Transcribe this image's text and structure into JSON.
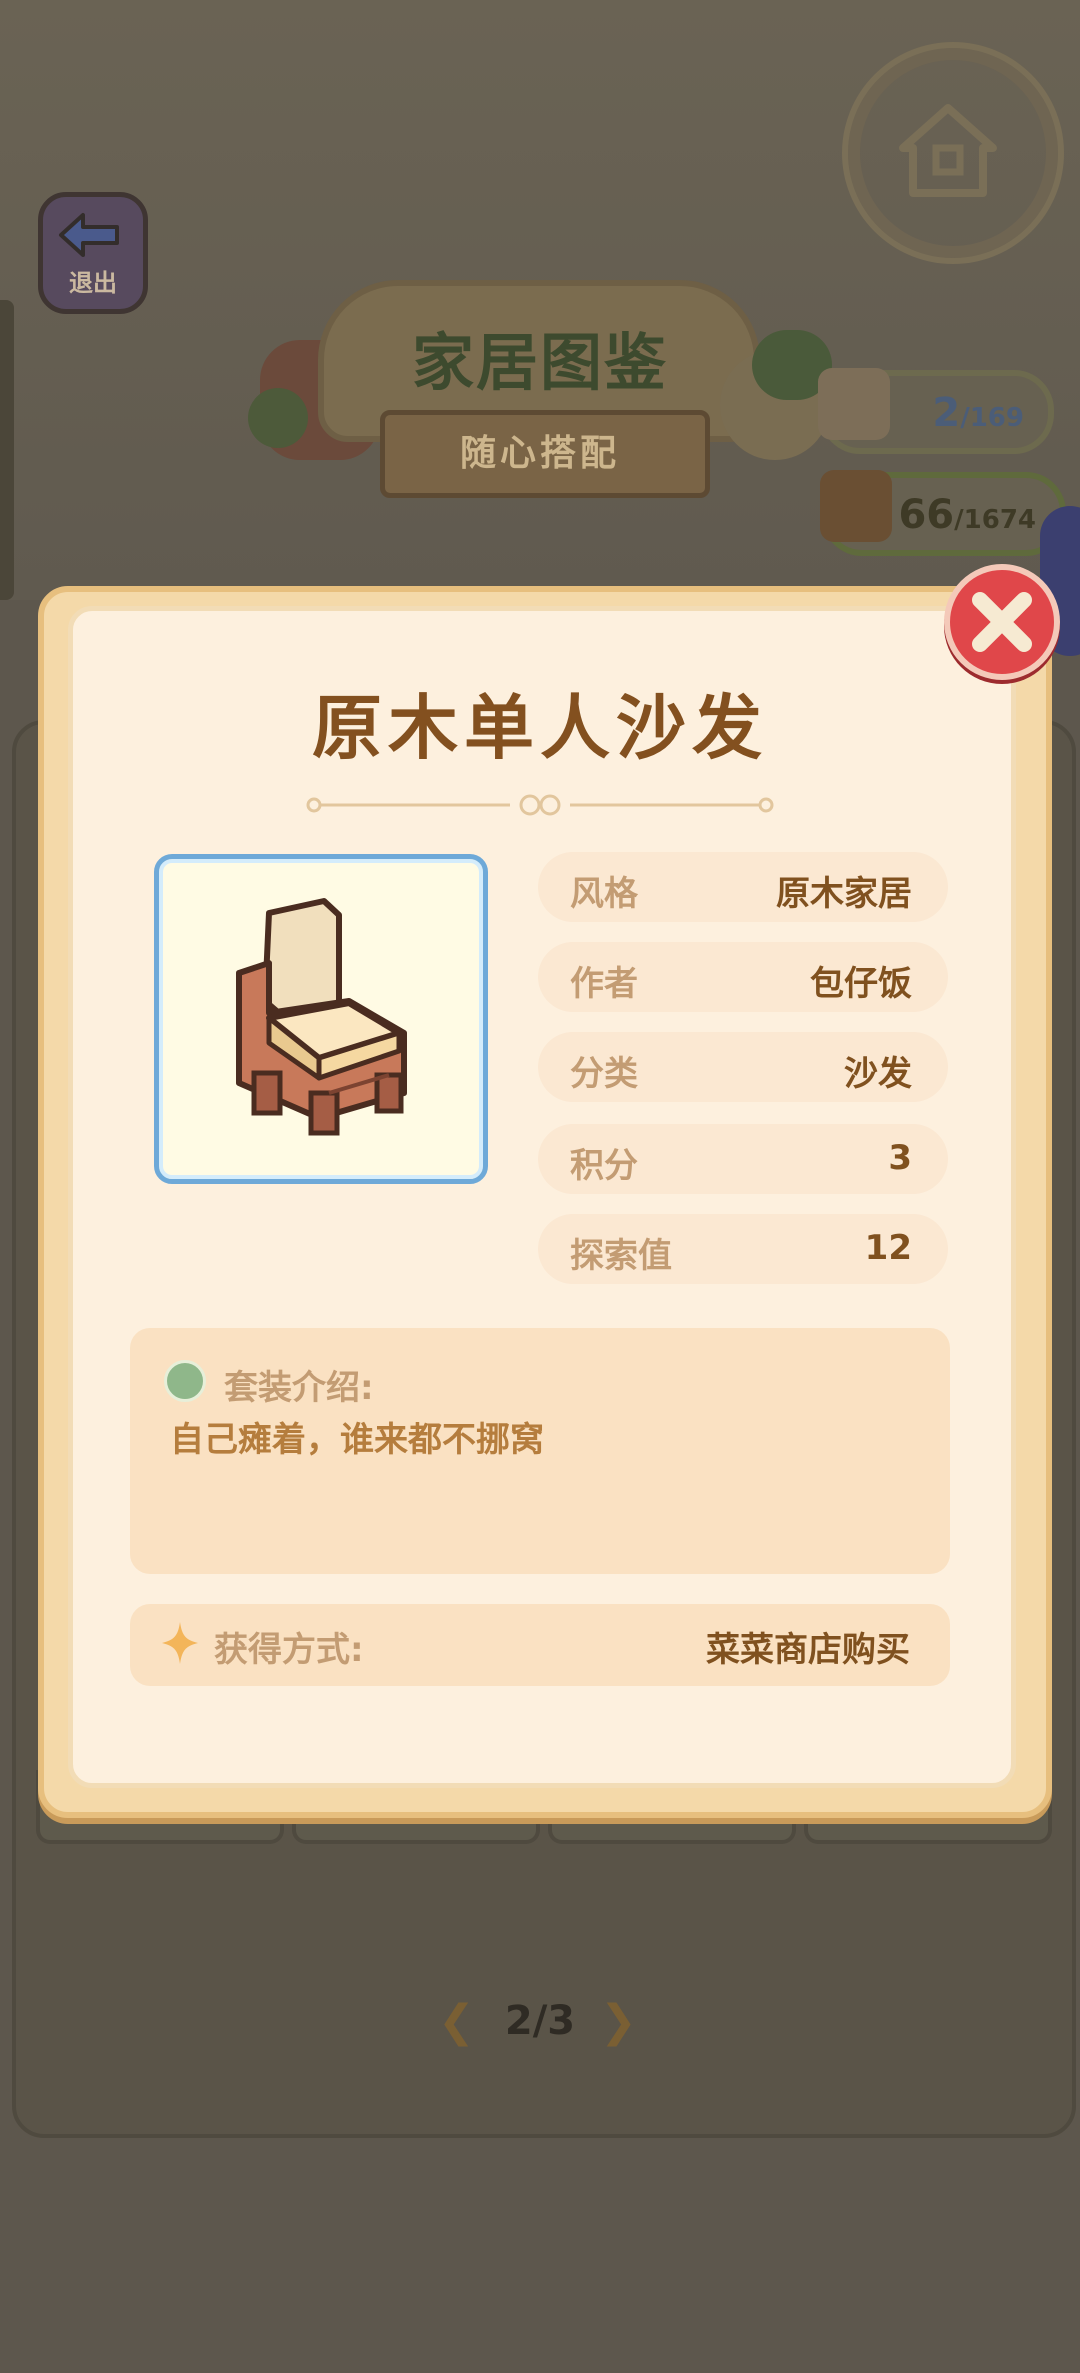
{
  "header": {
    "exit_label": "退出",
    "banner_title": "家居图鉴",
    "banner_subtitle": "随心搭配"
  },
  "counters": [
    {
      "icon": "rainbow-icon",
      "value": "2",
      "total": "/169"
    },
    {
      "icon": "book-icon",
      "value": "66",
      "total": "/1674"
    }
  ],
  "modal": {
    "title": "原木单人沙发",
    "item_image": "wooden-armchair-icon",
    "attributes": [
      {
        "label": "风格",
        "value": "原木家居"
      },
      {
        "label": "作者",
        "value": "包仔饭"
      },
      {
        "label": "分类",
        "value": "沙发"
      },
      {
        "label": "积分",
        "value": "3"
      },
      {
        "label": "探索值",
        "value": "12"
      }
    ],
    "description_heading": "套装介绍:",
    "description_text": "自己瘫着，谁来都不挪窝",
    "obtain_heading": "获得方式:",
    "obtain_value": "菜菜商店购买"
  },
  "pager": {
    "text": "2/3"
  },
  "colors": {
    "title": "#83501f",
    "label": "#c39c73",
    "close_button": "#e0474a",
    "frame_border": "#6ea9d8"
  }
}
